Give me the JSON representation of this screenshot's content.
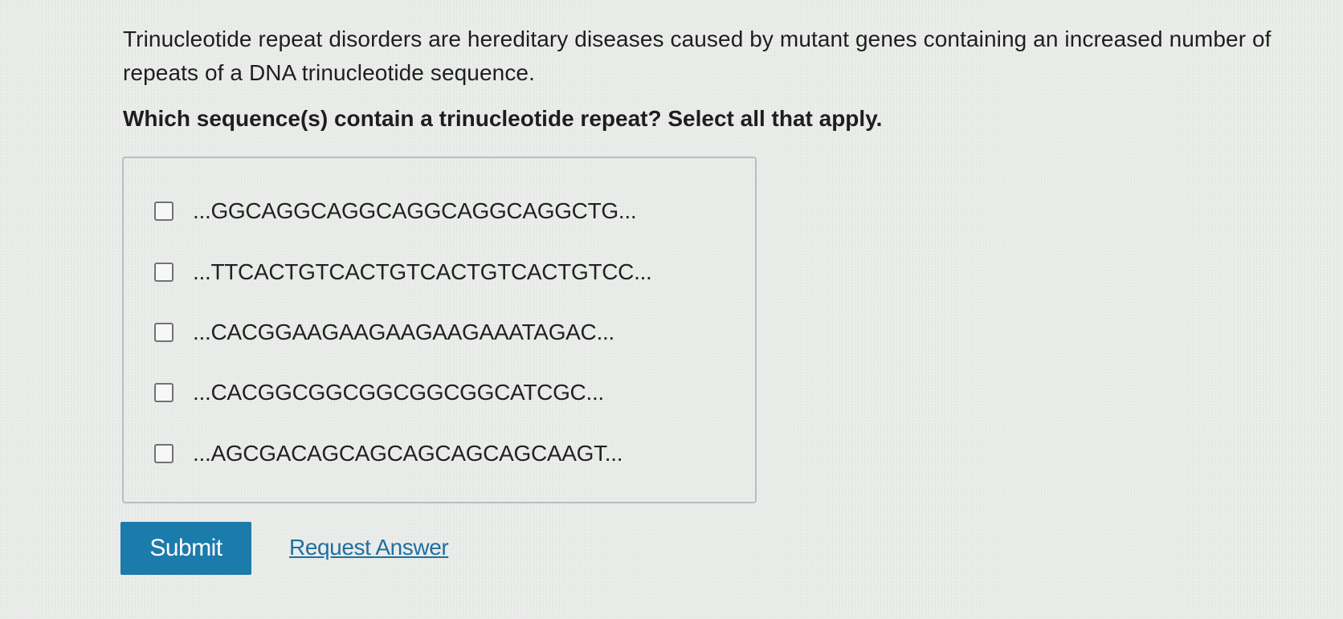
{
  "question": {
    "intro": "Trinucleotide repeat disorders are hereditary diseases caused by mutant genes containing an increased number of repeats of a DNA trinucleotide sequence.",
    "prompt": "Which sequence(s) contain a trinucleotide repeat? Select all that apply."
  },
  "options": [
    {
      "label": "...GGCAGGCAGGCAGGCAGGCAGGCTG...",
      "checked": false
    },
    {
      "label": "...TTCACTGTCACTGTCACTGTCACTGTCC...",
      "checked": false
    },
    {
      "label": "...CACGGAAGAAGAAGAAGAAATAGAC...",
      "checked": false
    },
    {
      "label": "...CACGGCGGCGGCGGCGGCATCGC...",
      "checked": false
    },
    {
      "label": "...AGCGACAGCAGCAGCAGCAGCAAGT...",
      "checked": false
    }
  ],
  "actions": {
    "submit_label": "Submit",
    "request_answer_label": "Request Answer"
  },
  "colors": {
    "submit_bg": "#1b7bab",
    "link": "#1f6fa0"
  }
}
